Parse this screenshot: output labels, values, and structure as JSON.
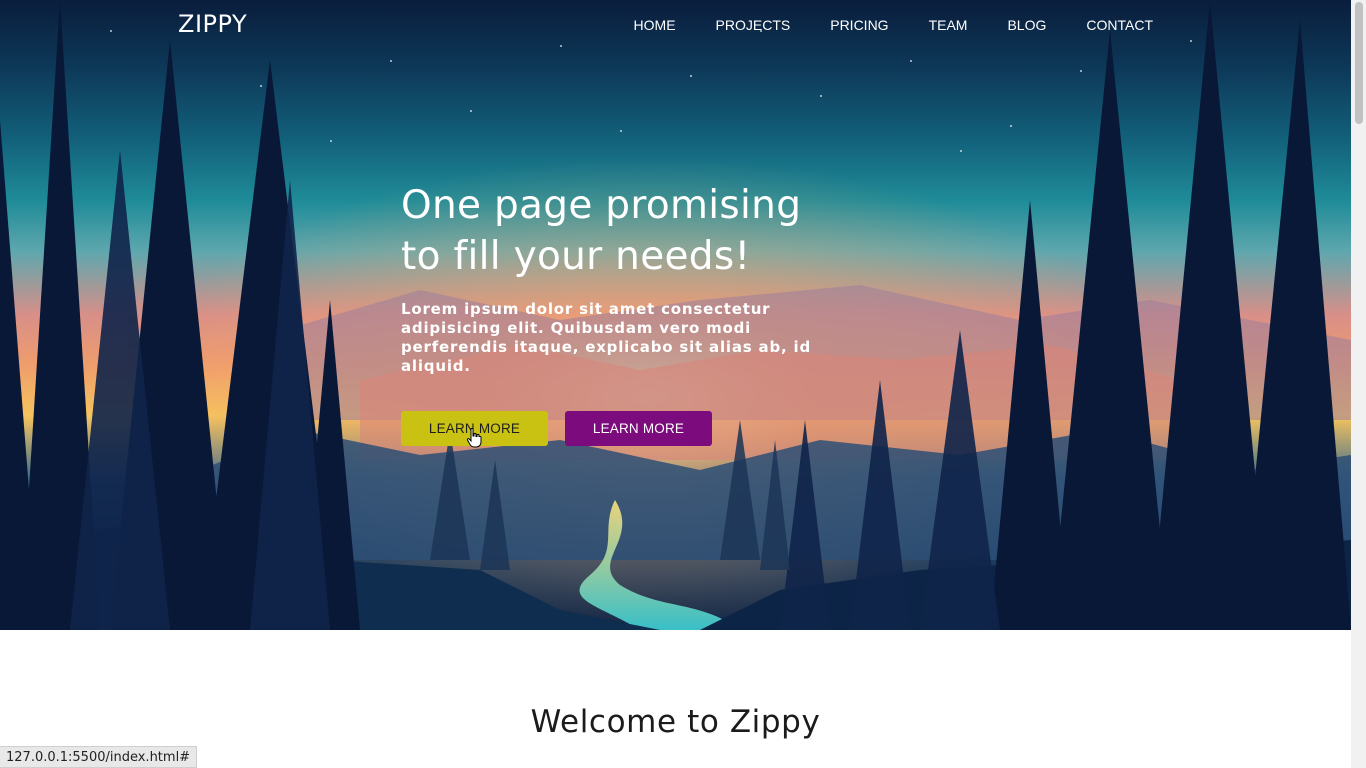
{
  "brand": {
    "name": "ZIPPY"
  },
  "nav": {
    "items": [
      {
        "label": "HOME"
      },
      {
        "label": "PROJECTS"
      },
      {
        "label": "PRICING"
      },
      {
        "label": "TEAM"
      },
      {
        "label": "BLOG"
      },
      {
        "label": "CONTACT"
      }
    ]
  },
  "hero": {
    "title_line1": "One page promising",
    "title_line2": "to fill your needs!",
    "text": "Lorem ipsum dolor sit amet consectetur adipisicing elit. Quibusdam vero modi perferendis itaque, explicabo sit alias ab, id aliquid.",
    "primary_button": "LEARN MORE",
    "secondary_button": "LEARN MORE",
    "background_icon": "forest-landscape-illustration"
  },
  "section": {
    "title": "Welcome to Zippy"
  },
  "status_bar": {
    "url": "127.0.0.1:5500/index.html#"
  },
  "colors": {
    "primary_button": "#c9c212",
    "secondary_button": "#7c0c7d",
    "text_light": "#ffffff",
    "text_dark": "#1b1b1b"
  }
}
